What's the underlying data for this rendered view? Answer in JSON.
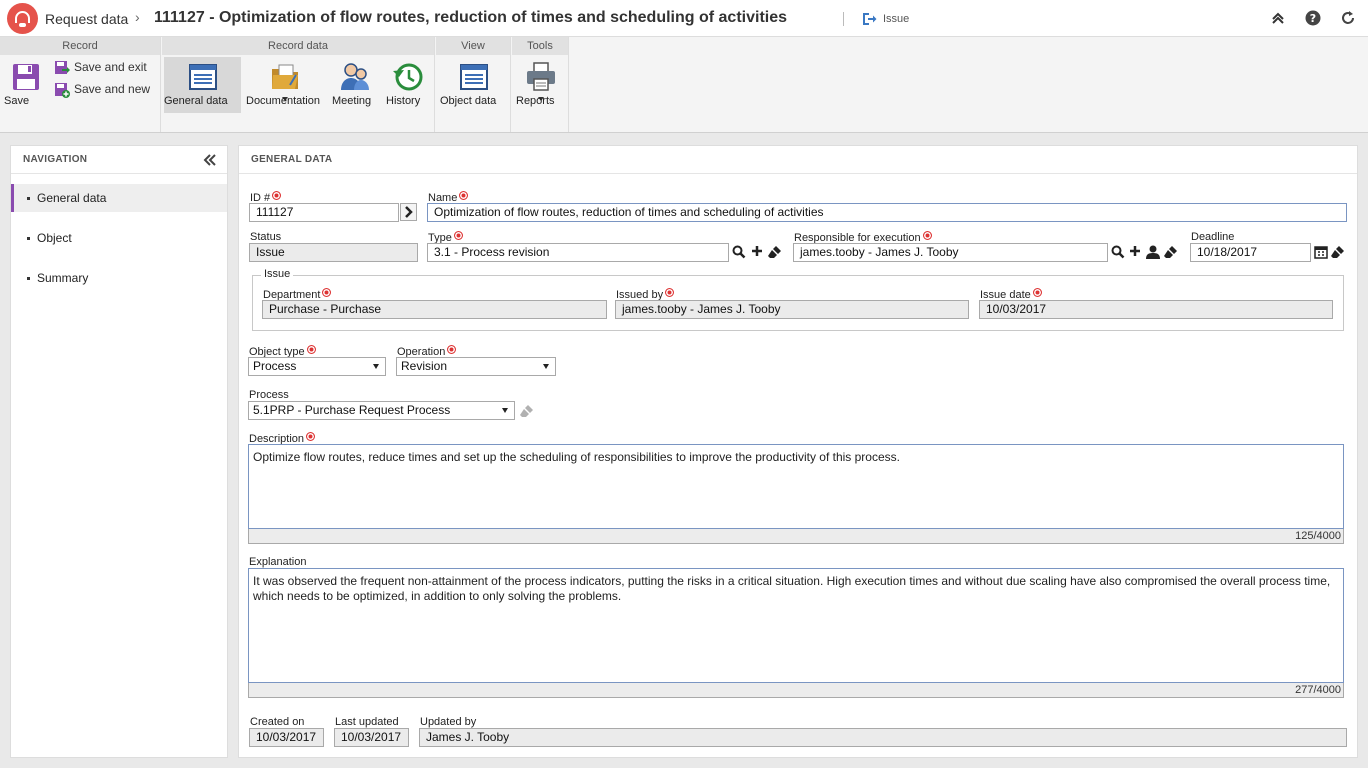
{
  "titlebar": {
    "app_name": "Request data",
    "separator": "›",
    "record_title": "111127 - Optimization of flow routes, reduction of times and scheduling of activities",
    "context_label": "Issue"
  },
  "ribbon": {
    "groups": {
      "record": "Record",
      "record_data": "Record data",
      "view": "View",
      "tools": "Tools"
    },
    "buttons": {
      "save": "Save",
      "save_exit": "Save and exit",
      "save_new": "Save and new",
      "general_data": "General data",
      "documentation": "Documentation",
      "meeting": "Meeting",
      "history": "History",
      "object_data": "Object data",
      "reports": "Reports"
    }
  },
  "navigation": {
    "header": "NAVIGATION",
    "items": [
      "General data",
      "Object",
      "Summary"
    ]
  },
  "main": {
    "header": "GENERAL DATA",
    "id": {
      "label": "ID #",
      "value": "111127"
    },
    "name": {
      "label": "Name",
      "value": "Optimization of flow routes, reduction of times and scheduling of activities"
    },
    "status": {
      "label": "Status",
      "value": "Issue"
    },
    "type": {
      "label": "Type",
      "value": "3.1 - Process revision"
    },
    "responsible": {
      "label": "Responsible for execution",
      "value": "james.tooby - James J. Tooby"
    },
    "deadline": {
      "label": "Deadline",
      "value": "10/18/2017"
    },
    "issue_section": {
      "legend": "Issue",
      "department": {
        "label": "Department",
        "value": "Purchase - Purchase"
      },
      "issued_by": {
        "label": "Issued by",
        "value": "james.tooby - James J. Tooby"
      },
      "issue_date": {
        "label": "Issue date",
        "value": "10/03/2017"
      }
    },
    "object_type": {
      "label": "Object type",
      "value": "Process"
    },
    "operation": {
      "label": "Operation",
      "value": "Revision"
    },
    "process": {
      "label": "Process",
      "value": "5.1PRP - Purchase Request Process"
    },
    "description": {
      "label": "Description",
      "value": "Optimize flow routes, reduce times and set up the scheduling of responsibilities to improve the productivity of this process.",
      "counter": "125/4000"
    },
    "explanation": {
      "label": "Explanation",
      "value": "It was observed the frequent non-attainment of the process indicators, putting the risks in a critical situation. High execution times and without due scaling have also compromised the overall process time, which needs to be optimized, in addition to only solving the problems.",
      "counter": "277/4000"
    },
    "created_on": {
      "label": "Created on",
      "value": "10/03/2017"
    },
    "last_updated": {
      "label": "Last updated",
      "value": "10/03/2017"
    },
    "updated_by": {
      "label": "Updated by",
      "value": "James J. Tooby"
    }
  }
}
